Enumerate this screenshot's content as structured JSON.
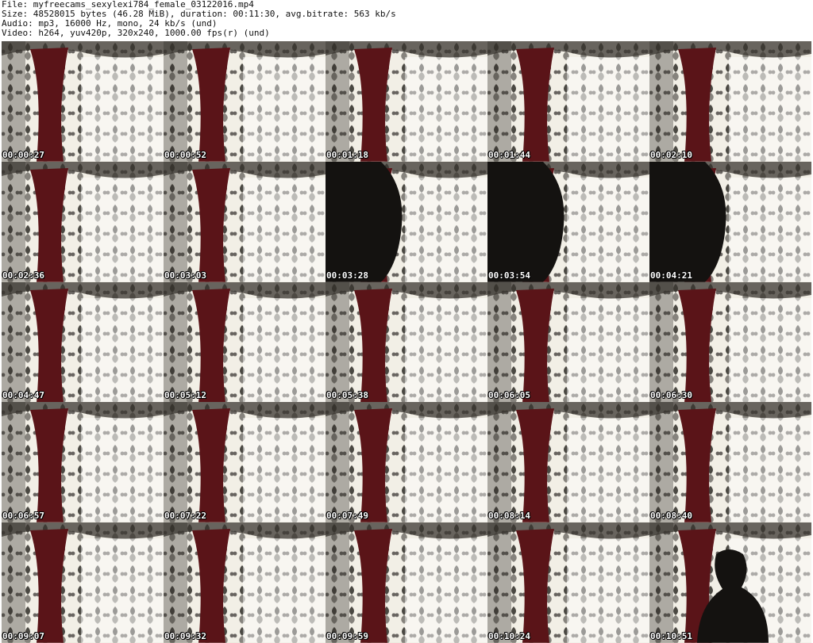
{
  "header": {
    "file_line": "File: myfreecams_sexylexi784_female_03122016.mp4",
    "size_line": "Size: 48528015 bytes (46.28 MiB), duration: 00:11:30, avg.bitrate: 563 kb/s",
    "audio_line": "Audio: mp3, 16000 Hz, mono, 24 kb/s (und)",
    "video_line": "Video: h264, yuv420p, 320x240, 1000.00 fps(r) (und)"
  },
  "colors": {
    "curtain_light": "#f2efe6",
    "curtain_pattern": "#2d2a26",
    "red_drape": "#5a1418",
    "valance": "#3a3630",
    "silhouette": "#141210"
  },
  "thumbnails": [
    {
      "timestamp": "00:00:27",
      "scene": "curtain"
    },
    {
      "timestamp": "00:00:52",
      "scene": "curtain"
    },
    {
      "timestamp": "00:01:18",
      "scene": "curtain"
    },
    {
      "timestamp": "00:01:44",
      "scene": "curtain"
    },
    {
      "timestamp": "00:02:10",
      "scene": "curtain"
    },
    {
      "timestamp": "00:02:36",
      "scene": "curtain"
    },
    {
      "timestamp": "00:03:03",
      "scene": "curtain"
    },
    {
      "timestamp": "00:03:28",
      "scene": "silhouette"
    },
    {
      "timestamp": "00:03:54",
      "scene": "silhouette"
    },
    {
      "timestamp": "00:04:21",
      "scene": "silhouette"
    },
    {
      "timestamp": "00:04:47",
      "scene": "curtain"
    },
    {
      "timestamp": "00:05:12",
      "scene": "curtain"
    },
    {
      "timestamp": "00:05:38",
      "scene": "curtain"
    },
    {
      "timestamp": "00:06:05",
      "scene": "curtain"
    },
    {
      "timestamp": "00:06:30",
      "scene": "curtain"
    },
    {
      "timestamp": "00:06:57",
      "scene": "curtain"
    },
    {
      "timestamp": "00:07:22",
      "scene": "curtain"
    },
    {
      "timestamp": "00:07:49",
      "scene": "curtain"
    },
    {
      "timestamp": "00:08:14",
      "scene": "curtain"
    },
    {
      "timestamp": "00:08:40",
      "scene": "curtain"
    },
    {
      "timestamp": "00:09:07",
      "scene": "curtain"
    },
    {
      "timestamp": "00:09:32",
      "scene": "curtain"
    },
    {
      "timestamp": "00:09:59",
      "scene": "curtain"
    },
    {
      "timestamp": "00:10:24",
      "scene": "curtain"
    },
    {
      "timestamp": "00:10:51",
      "scene": "person"
    }
  ]
}
